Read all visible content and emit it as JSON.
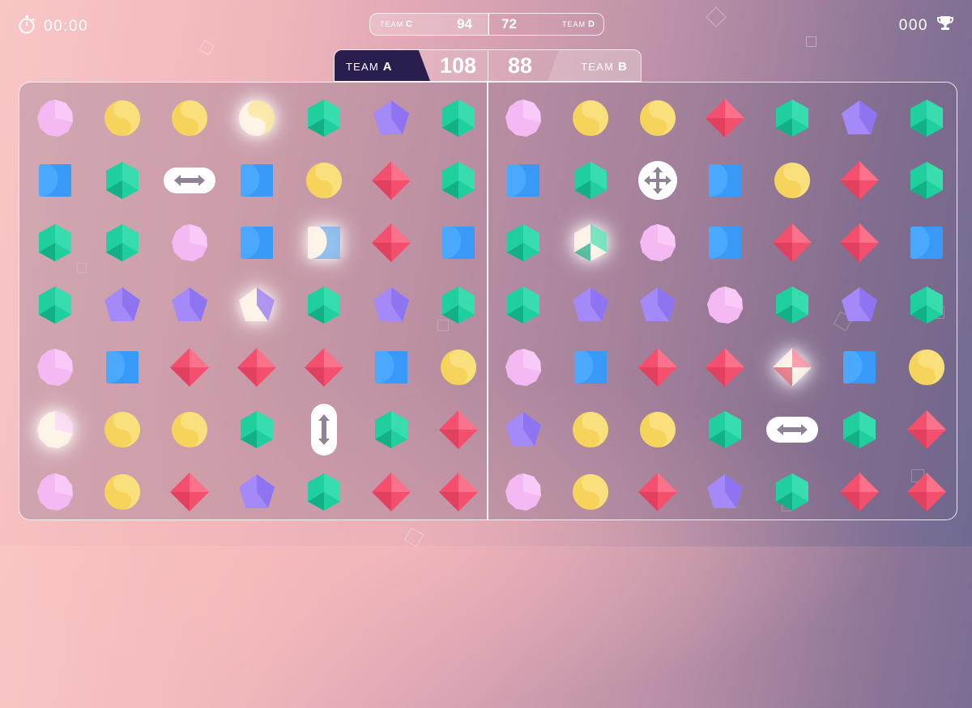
{
  "hud": {
    "timer": "00:00",
    "timer_icon": "stopwatch-icon",
    "score": "000",
    "score_icon": "trophy-icon"
  },
  "mini_scoreboard": {
    "left_team_prefix": "TEAM",
    "left_team_letter": "C",
    "left_score": "94",
    "right_score": "72",
    "right_team_prefix": "TEAM",
    "right_team_letter": "D"
  },
  "main_scoreboard": {
    "left_team_prefix": "TEAM",
    "left_team_letter": "A",
    "left_score": "108",
    "right_score": "88",
    "right_team_prefix": "TEAM",
    "right_team_letter": "B"
  },
  "colors": {
    "pink": "#f4b8f2",
    "yellow": "#f6d35a",
    "green": "#1fcf9e",
    "purple": "#a48af8",
    "blue": "#4aa8ff",
    "red": "#f4506e",
    "team_a_tab": "#2a1e4e"
  },
  "gem_legend": {
    "P": "pink-gem",
    "Y": "yellow-gem",
    "G": "green-gem",
    "V": "purple-gem",
    "B": "blue-gem",
    "R": "red-gem",
    "H": "horizontal-swap-powerup",
    "X": "vertical-swap-powerup",
    "M": "move-cross-powerup",
    "*": "glowing suffix"
  },
  "boards": [
    {
      "name": "team-a-board",
      "rows": [
        [
          "P",
          "Y",
          "Y",
          "Y*",
          "G",
          "V",
          "G"
        ],
        [
          "B",
          "G",
          "H",
          "B",
          "Y",
          "R",
          "G"
        ],
        [
          "G",
          "G",
          "P",
          "B",
          "B*",
          "R",
          "B"
        ],
        [
          "G",
          "V",
          "V",
          "V*",
          "G",
          "V",
          "G"
        ],
        [
          "P",
          "B",
          "R",
          "R",
          "R",
          "B",
          "Y"
        ],
        [
          "P*",
          "Y",
          "Y",
          "G",
          "X",
          "G",
          "R"
        ],
        [
          "P",
          "Y",
          "R",
          "V",
          "G",
          "R",
          "R"
        ]
      ]
    },
    {
      "name": "team-b-board",
      "rows": [
        [
          "P",
          "Y",
          "Y",
          "R",
          "G",
          "V",
          "G"
        ],
        [
          "B",
          "G",
          "M",
          "B",
          "Y",
          "R",
          "G"
        ],
        [
          "G",
          "G*",
          "P",
          "B",
          "R",
          "R",
          "B"
        ],
        [
          "G",
          "V",
          "V",
          "P",
          "G",
          "V",
          "G"
        ],
        [
          "P",
          "B",
          "R",
          "R",
          "R*",
          "B",
          "Y"
        ],
        [
          "V",
          "Y",
          "Y",
          "G",
          "H",
          "G",
          "R"
        ],
        [
          "P",
          "Y",
          "R",
          "V",
          "G",
          "R",
          "R"
        ]
      ]
    }
  ]
}
